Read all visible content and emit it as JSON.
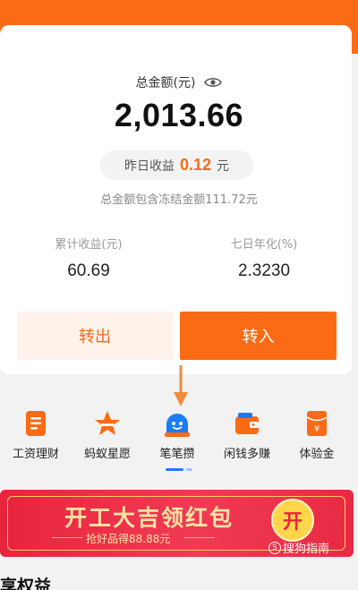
{
  "summary": {
    "total_label": "总金额(元)",
    "total_amount": "2,013.66",
    "yesterday_label": "昨日收益",
    "yesterday_value": "0.12",
    "yesterday_unit": "元",
    "frozen_note": "总金额包含冻结金额111.72元"
  },
  "stats": {
    "cumulative_label": "累计收益(元)",
    "cumulative_value": "60.69",
    "annualized_label": "七日年化(%)",
    "annualized_value": "2.3230"
  },
  "actions": {
    "transfer_out": "转出",
    "transfer_in": "转入"
  },
  "shortcuts": [
    {
      "label": "工资理财",
      "icon": "document-icon"
    },
    {
      "label": "蚂蚁星愿",
      "icon": "star-wish-icon"
    },
    {
      "label": "笔笔攒",
      "icon": "smiley-robot-icon"
    },
    {
      "label": "闲钱多赚",
      "icon": "wallet-icon"
    },
    {
      "label": "体验金",
      "icon": "red-envelope-icon"
    }
  ],
  "banner": {
    "title": "开工大吉领红包",
    "subtitle": "抢好品得88.88元",
    "badge": "开"
  },
  "watermark": "搜狗指南",
  "section_heading": "享权益",
  "colors": {
    "accent": "#fb6a14",
    "banner_red": "#e8243c",
    "gold": "#ffe4a3"
  }
}
